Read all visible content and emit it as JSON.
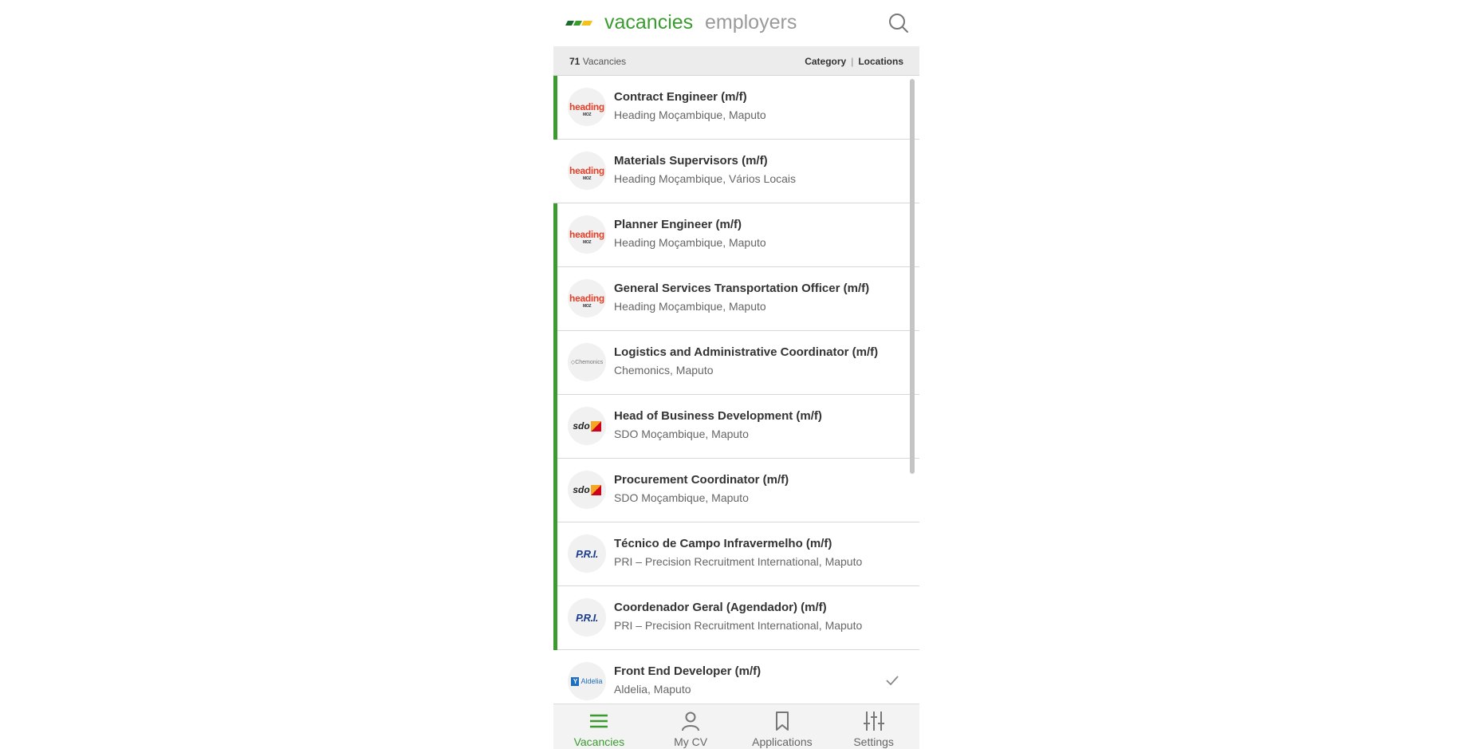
{
  "header": {
    "tab_vacancies": "vacancies",
    "tab_employers": "employers",
    "accent_color": "#3a9b2f"
  },
  "filter_bar": {
    "count": "71",
    "count_label": "Vacancies",
    "category": "Category",
    "separator": "|",
    "locations": "Locations"
  },
  "vacancies": [
    {
      "title": "Contract Engineer (m/f)",
      "subtitle": "Heading Moçambique, Maputo",
      "logo": "heading",
      "unread": true
    },
    {
      "title": "Materials Supervisors (m/f)",
      "subtitle": "Heading Moçambique, Vários Locais",
      "logo": "heading",
      "unread": false
    },
    {
      "title": "Planner Engineer (m/f)",
      "subtitle": "Heading Moçambique, Maputo",
      "logo": "heading",
      "unread": true
    },
    {
      "title": "General Services Transportation Officer (m/f)",
      "subtitle": "Heading Moçambique, Maputo",
      "logo": "heading",
      "unread": true
    },
    {
      "title": "Logistics and Administrative Coordinator (m/f)",
      "subtitle": "Chemonics, Maputo",
      "logo": "chemonics",
      "unread": true
    },
    {
      "title": "Head of Business Development (m/f)",
      "subtitle": "SDO Moçambique, Maputo",
      "logo": "sdo",
      "unread": true
    },
    {
      "title": "Procurement Coordinator (m/f)",
      "subtitle": "SDO Moçambique, Maputo",
      "logo": "sdo",
      "unread": true
    },
    {
      "title": "Técnico de Campo Infravermelho (m/f)",
      "subtitle": "PRI – Precision Recruitment International, Maputo",
      "logo": "pri",
      "unread": true
    },
    {
      "title": "Coordenador Geral (Agendador) (m/f)",
      "subtitle": "PRI – Precision Recruitment International, Maputo",
      "logo": "pri",
      "unread": true
    },
    {
      "title": "Front End Developer (m/f)",
      "subtitle": "Aldelia, Maputo",
      "logo": "aldelia",
      "unread": false,
      "applied": true
    }
  ],
  "logos": {
    "heading_text": "heading",
    "heading_sub": "MOZ",
    "chemonics_text": "Chemonics",
    "sdo_text": "sdo",
    "pri_text": "P.R.I.",
    "aldelia_text": "Aldelia",
    "aldelia_mark": "Y"
  },
  "bottom_nav": {
    "vacancies": "Vacancies",
    "my_cv": "My CV",
    "applications": "Applications",
    "settings": "Settings"
  },
  "icons": {
    "search": "search-icon",
    "check": "check-icon",
    "menu": "menu-icon",
    "person": "person-icon",
    "bookmark": "bookmark-icon",
    "sliders": "sliders-icon"
  }
}
